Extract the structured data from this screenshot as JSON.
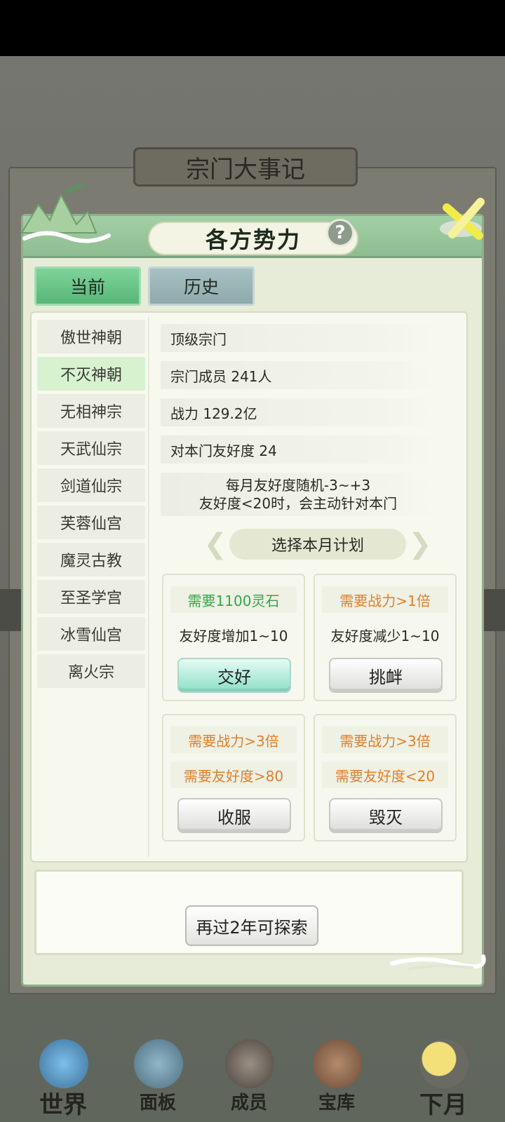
{
  "background": {
    "panel_title": "宗门大事记"
  },
  "dialog": {
    "title": "各方势力",
    "help_symbol": "?",
    "tabs": [
      {
        "label": "当前",
        "active": true
      },
      {
        "label": "历史",
        "active": false
      }
    ],
    "sects": [
      {
        "name": "傲世神朝",
        "active": false
      },
      {
        "name": "不灭神朝",
        "active": true
      },
      {
        "name": "无相神宗",
        "active": false
      },
      {
        "name": "天武仙宗",
        "active": false
      },
      {
        "name": "剑道仙宗",
        "active": false
      },
      {
        "name": "芙蓉仙宫",
        "active": false
      },
      {
        "name": "魔灵古教",
        "active": false
      },
      {
        "name": "至圣学宫",
        "active": false
      },
      {
        "name": "冰雪仙宫",
        "active": false
      },
      {
        "name": "离火宗",
        "active": false
      }
    ],
    "info": {
      "rank": "顶级宗门",
      "members": "宗门成员 241人",
      "power": "战力 129.2亿",
      "friendship": "对本门友好度 24",
      "note_line1": "每月友好度随机-3~+3",
      "note_line2": "友好度<20时，会主动针对本门"
    },
    "plan_title": "选择本月计划",
    "plans": [
      {
        "row1": "需要1100灵石",
        "row2": "友好度增加1~10",
        "button": "交好"
      },
      {
        "row1": "需要战力>1倍",
        "row2": "友好度减少1~10",
        "button": "挑衅"
      },
      {
        "row1": "需要战力>3倍",
        "row2": "需要友好度>80",
        "button": "收服"
      },
      {
        "row1": "需要战力>3倍",
        "row2": "需要友好度<20",
        "button": "毁灭"
      }
    ],
    "explore_button": "再过2年可探索"
  },
  "nav": [
    {
      "label": "世界",
      "icon": "world-icon"
    },
    {
      "label": "面板",
      "icon": "panel-icon"
    },
    {
      "label": "成员",
      "icon": "members-icon"
    },
    {
      "label": "宝库",
      "icon": "treasury-icon"
    },
    {
      "label": "下月",
      "icon": "next-month-icon"
    }
  ],
  "colors": {
    "tab_active": "#58b678",
    "req_green": "#36a64a",
    "req_orange": "#e0802c",
    "header_green": "#8dbd90"
  }
}
